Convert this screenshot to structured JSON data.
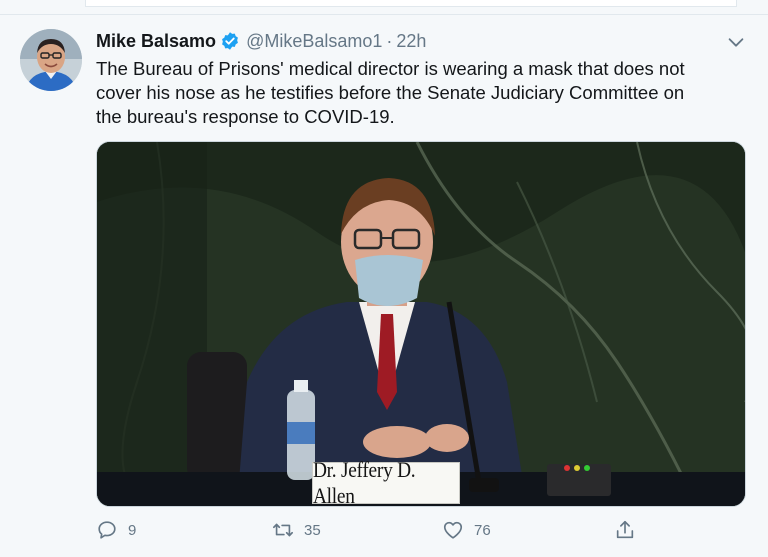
{
  "tweet": {
    "author_name": "Mike Balsamo",
    "handle": "@MikeBalsamo1",
    "separator": "·",
    "time": "22h",
    "text": [
      "The Bureau of Prisons' medical director is wearing a mask that does not",
      "cover his nose as he testifies before the Senate Judiciary Committee on",
      "the bureau's response to COVID-19."
    ],
    "media": {
      "nameplate": "Dr. Jeffery D. Allen"
    },
    "actions": {
      "replies": "9",
      "retweets": "35",
      "likes": "76"
    }
  },
  "colors": {
    "accent": "#1da1f2",
    "secondary_text": "#657786",
    "background": "#f5f8fa"
  },
  "icons": {
    "verified": "verified-badge-icon",
    "more": "chevron-down-icon",
    "reply": "reply-icon",
    "retweet": "retweet-icon",
    "like": "heart-icon",
    "share": "share-icon"
  }
}
